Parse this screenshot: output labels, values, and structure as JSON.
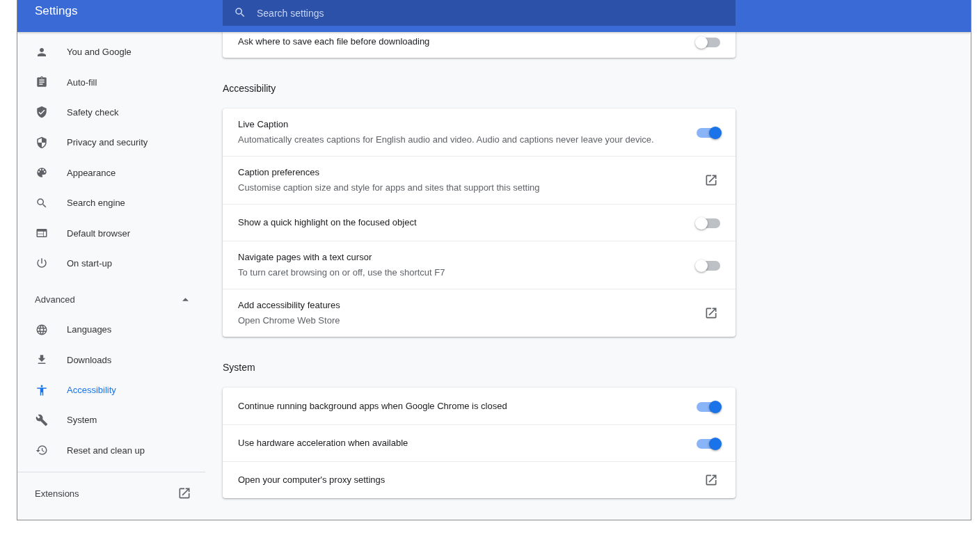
{
  "header": {
    "title": "Settings",
    "search": {
      "placeholder": "Search settings"
    }
  },
  "sidebar": {
    "items": [
      {
        "label": "You and Google",
        "selected": false
      },
      {
        "label": "Auto-fill",
        "selected": false
      },
      {
        "label": "Safety check",
        "selected": false
      },
      {
        "label": "Privacy and security",
        "selected": false
      },
      {
        "label": "Appearance",
        "selected": false
      },
      {
        "label": "Search engine",
        "selected": false
      },
      {
        "label": "Default browser",
        "selected": false
      },
      {
        "label": "On start-up",
        "selected": false
      }
    ],
    "advanced": {
      "label": "Advanced",
      "expanded": true
    },
    "advanced_items": [
      {
        "label": "Languages",
        "selected": false
      },
      {
        "label": "Downloads",
        "selected": false
      },
      {
        "label": "Accessibility",
        "selected": true
      },
      {
        "label": "System",
        "selected": false
      },
      {
        "label": "Reset and clean up",
        "selected": false
      }
    ],
    "extensions": {
      "label": "Extensions"
    }
  },
  "sections": [
    {
      "rows": [
        {
          "kind": "toggle",
          "title": "Ask where to save each file before downloading",
          "on": false
        }
      ]
    },
    {
      "title": "Accessibility",
      "rows": [
        {
          "kind": "toggle",
          "title": "Live Caption",
          "description": "Automatically creates captions for English audio and video. Audio and captions never leave your device.",
          "on": true
        },
        {
          "kind": "link",
          "title": "Caption preferences",
          "description": "Customise caption size and style for apps and sites that support this setting"
        },
        {
          "kind": "toggle",
          "title": "Show a quick highlight on the focused object",
          "on": false
        },
        {
          "kind": "toggle",
          "title": "Navigate pages with a text cursor",
          "description": "To turn caret browsing on or off, use the shortcut F7",
          "on": false
        },
        {
          "kind": "link",
          "title": "Add accessibility features",
          "description": "Open Chrome Web Store"
        }
      ]
    },
    {
      "title": "System",
      "rows": [
        {
          "kind": "toggle",
          "title": "Continue running background apps when Google Chrome is closed",
          "on": true
        },
        {
          "kind": "toggle",
          "title": "Use hardware acceleration when available",
          "on": true
        },
        {
          "kind": "link",
          "title": "Open your computer's proxy settings"
        }
      ]
    }
  ]
}
